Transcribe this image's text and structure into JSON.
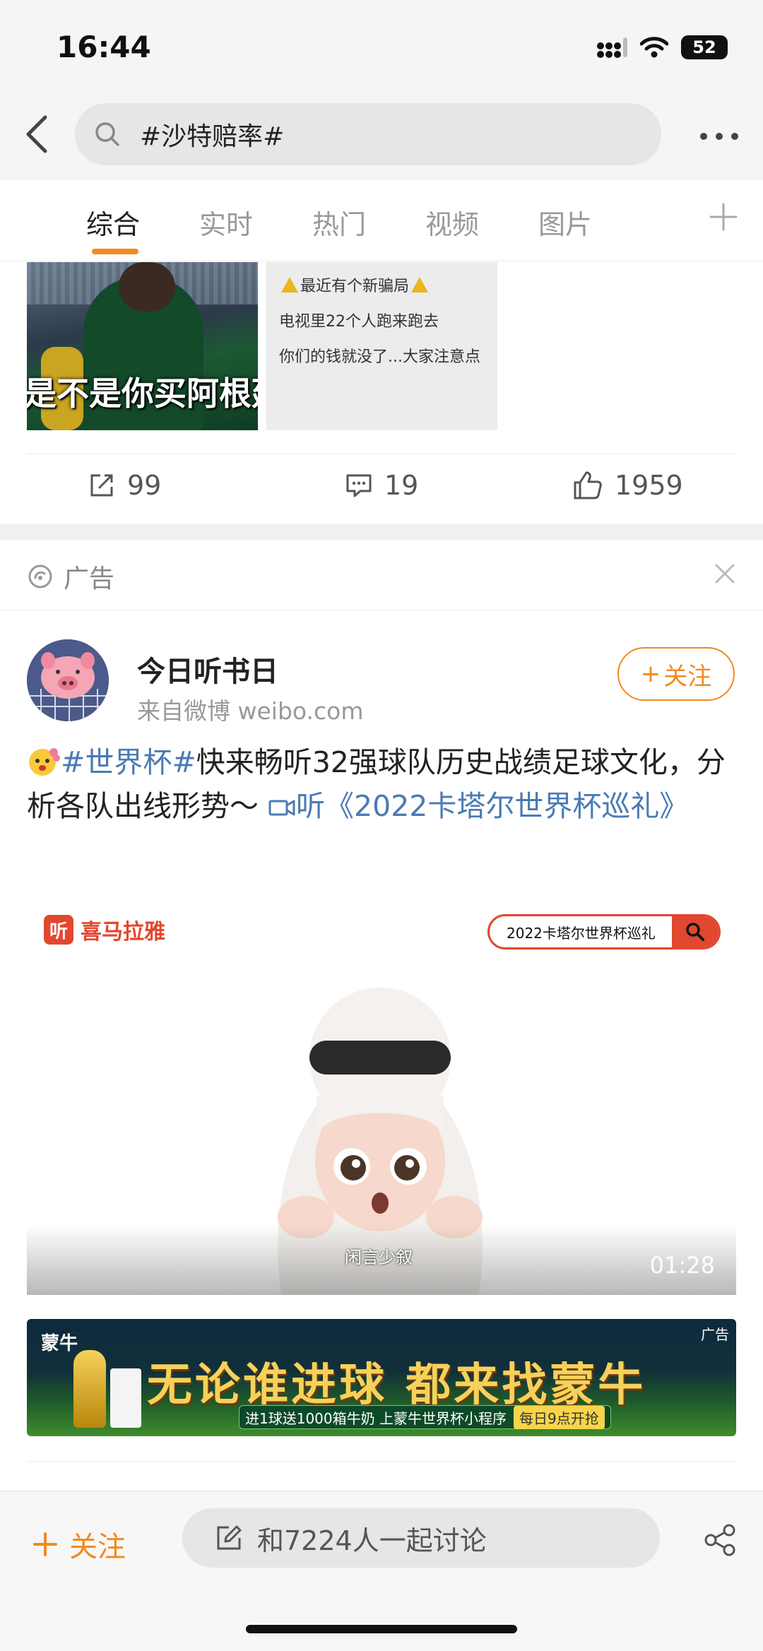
{
  "status_bar": {
    "time": "16:44",
    "battery": "52"
  },
  "header": {
    "search_query": "#沙特赔率#"
  },
  "tabs": [
    {
      "label": "综合",
      "active": true
    },
    {
      "label": "实时",
      "active": false
    },
    {
      "label": "热门",
      "active": false
    },
    {
      "label": "视频",
      "active": false
    },
    {
      "label": "图片",
      "active": false
    }
  ],
  "previous_post": {
    "image1_caption": "是不是你买阿根廷",
    "image2_lines": [
      "最近有个新骗局",
      "电视里22个人跑来跑去",
      "你们的钱就没了...大家注意点"
    ],
    "reposts": "99",
    "comments": "19",
    "likes": "1959"
  },
  "ad_header": {
    "label": "广告"
  },
  "post": {
    "author": "今日听书日",
    "source": "来自微博 weibo.com",
    "follow_label": "关注",
    "hashtag": "#世界杯#",
    "text": "快来畅听32强球队历史战绩足球文化，分析各队出线形势～",
    "link_text": "听《2022卡塔尔世界杯巡礼》"
  },
  "video": {
    "brand": "喜马拉雅",
    "brand_logo": "听",
    "search_text": "2022卡塔尔世界杯巡礼",
    "subtitle": "闲言少叙",
    "duration": "01:28"
  },
  "banner": {
    "brand": "蒙牛",
    "tag": "广告",
    "headline": "无论谁进球 都来找蒙牛",
    "sub_text": "进1球送1000箱牛奶  上蒙牛世界杯小程序",
    "cta": "每日9点开抢"
  },
  "bottom_bar": {
    "follow_label": "关注",
    "discuss_label": "和7224人一起讨论"
  },
  "colors": {
    "accent": "#f28a20",
    "link": "#4a7ab5"
  }
}
